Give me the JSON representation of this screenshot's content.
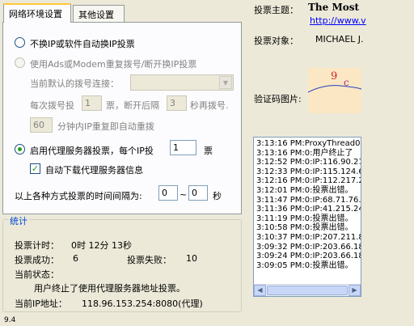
{
  "tabs": [
    "网络环境设置",
    "其他设置"
  ],
  "options": {
    "no_change_ip_label": "不换IP或软件自动换IP投票",
    "adsl_modem_label": "使用Ads或Modem重复拨号/断开换IP投票",
    "dial_conn_label": "当前默认的拨号连接：",
    "dial_conn_value": "",
    "dial_per_vote_prefix": "每次拨号投",
    "dial_per_vote_value": "1",
    "dial_per_vote_mid": "票，断开后隔",
    "redial_wait_value": "3",
    "redial_wait_suffix": "秒再拨号.",
    "auto_redial_value": "60",
    "auto_redial_suffix": "分钟内IP重复即自动重拨",
    "proxy_label_prefix": "启用代理服务器投票，每个IP投",
    "proxy_votes_value": "1",
    "proxy_votes_suffix": "票",
    "auto_download_label": "自动下载代理服务器信息",
    "interval_prefix": "以上各种方式投票的时间间隔为:",
    "interval_from": "0",
    "interval_sep": "~",
    "interval_to": "0",
    "interval_unit": "秒"
  },
  "stats": {
    "title": "统计",
    "time_label": "投票计时：",
    "time_value": "0时 12分 13秒",
    "success_label": "投票成功：",
    "success_value": "6",
    "fail_label": "投票失败：",
    "fail_value": "10",
    "status_label": "当前状态：",
    "status_text": "用户终止了使用代理服务器地址投票。",
    "ip_label": "当前IP地址：",
    "ip_value": "118.96.153.254:8080(代理)"
  },
  "vote": {
    "subject_label": "投票主题：",
    "subject_value": "The Most",
    "url_value": "http://www.v",
    "target_label": "投票对象：",
    "target_value": "MICHAEL J.",
    "captcha_label": "验证码图片:"
  },
  "log": [
    "3:13:16 PM:ProxyThread0:",
    "3:13:16 PM:0:用户终止了",
    "3:12:52 PM:0:IP:116.90.21",
    "3:12:33 PM:0:IP:115.124.6",
    "3:12:16 PM:0:IP:112.217.2",
    "3:12:01 PM:0:投票出错。",
    "3:11:47 PM:0:IP:68.71.76.2",
    "3:11:36 PM:0:IP:41.215.24",
    "3:11:19 PM:0:投票出错。",
    "3:10:58 PM:0:投票出错。",
    "3:10:37 PM:0:IP:207.211.8",
    "3:09:32 PM:0:IP:203.66.18",
    "3:09:24 PM:0:IP:203.66.18",
    "3:09:05 PM:0:投票出错。"
  ],
  "footer_text": "9.4",
  "accent_color": "#ffc83c",
  "group_title_color": "#0046d5"
}
